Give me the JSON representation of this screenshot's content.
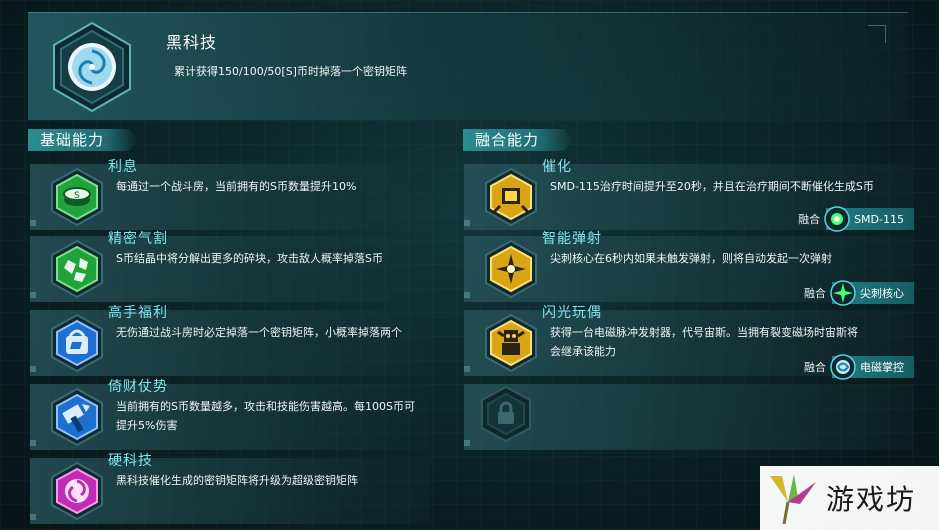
{
  "header": {
    "title": "黑科技",
    "description": "累计获得150/100/50[S]币时掉落一个密钥矩阵",
    "icon": "hex-vortex-icon"
  },
  "basic": {
    "section_title": "基础能力",
    "items": [
      {
        "title": "利息",
        "desc": "每通过一个战斗房，当前拥有的S币数量提升10%",
        "icon": "coin-stack-icon",
        "color": "#1fa33a"
      },
      {
        "title": "精密气割",
        "desc": "S币结晶中将分解出更多的碎块，攻击敌人概率掉落S币",
        "icon": "crystal-shards-icon",
        "color": "#1fa33a"
      },
      {
        "title": "高手福利",
        "desc": "无伤通过战斗房时必定掉落一个密钥矩阵，小概率掉落两个",
        "icon": "gift-bag-icon",
        "color": "#1f6fd1"
      },
      {
        "title": "倚财仗势",
        "desc": "当前拥有的S币数量越多，攻击和技能伤害越高。每100S币可提升5%伤害",
        "icon": "money-sword-icon",
        "color": "#1f6fd1"
      },
      {
        "title": "硬科技",
        "desc": "黑科技催化生成的密钥矩阵将升级为超级密钥矩阵",
        "icon": "vortex-icon",
        "color": "#c22bb6"
      }
    ]
  },
  "fusion": {
    "section_title": "融合能力",
    "items": [
      {
        "title": "催化",
        "desc": "SMD-115治疗时间提升至20秒，并且在治疗期间不断催化生成S币",
        "icon": "drone-icon",
        "color": "#d9a514",
        "fusion_label": "融合",
        "fusion_name": "SMD-115",
        "fusion_icon": "drone-core-icon"
      },
      {
        "title": "智能弹射",
        "desc": "尖刺核心在6秒内如果未触发弹射，则将自动发起一次弹射",
        "icon": "spike-burst-icon",
        "color": "#d9a514",
        "fusion_label": "融合",
        "fusion_name": "尖刺核心",
        "fusion_icon": "spike-core-icon"
      },
      {
        "title": "闪光玩偶",
        "desc": "获得一台电磁脉冲发射器，代号宙斯。当拥有裂变磁场时宙斯将会继承该能力",
        "icon": "robot-doll-icon",
        "color": "#d9a514",
        "fusion_label": "融合",
        "fusion_name": "电磁掌控",
        "fusion_icon": "em-palm-icon"
      }
    ],
    "locked_icon": "lock-icon"
  },
  "watermark": {
    "text": "游戏坊"
  }
}
